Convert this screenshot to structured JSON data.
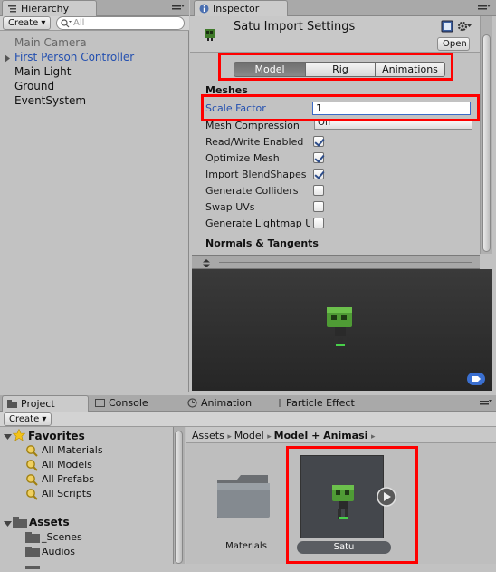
{
  "hierarchy": {
    "tab_label": "Hierarchy",
    "create_label": "Create ▾",
    "search_placeholder": "All",
    "items": [
      "Main Camera",
      "First Person Controller",
      "Main Light",
      "Ground",
      "EventSystem"
    ]
  },
  "inspector": {
    "tab_label": "Inspector",
    "title": "Satu Import Settings",
    "open_label": "Open",
    "tabs": [
      "Model",
      "Rig",
      "Animations"
    ],
    "selected_tab": "Model",
    "section_meshes": "Meshes",
    "scale_factor_label": "Scale Factor",
    "scale_factor_value": "1",
    "mesh_compression_label": "Mesh Compression",
    "mesh_compression_value": "Off",
    "options": [
      {
        "label": "Read/Write Enabled",
        "checked": true
      },
      {
        "label": "Optimize Mesh",
        "checked": true
      },
      {
        "label": "Import BlendShapes",
        "checked": true
      },
      {
        "label": "Generate Colliders",
        "checked": false
      },
      {
        "label": "Swap UVs",
        "checked": false
      },
      {
        "label": "Generate Lightmap UVs",
        "checked": false
      }
    ],
    "section_normals": "Normals & Tangents"
  },
  "bottom_tabs": [
    "Project",
    "Console",
    "Animation",
    "Particle Effect"
  ],
  "project": {
    "create_label": "Create ▾",
    "favorites_label": "Favorites",
    "favorites": [
      "All Materials",
      "All Models",
      "All Prefabs",
      "All Scripts"
    ],
    "assets_label": "Assets",
    "asset_folders": [
      "_Scenes",
      "Audios"
    ],
    "breadcrumb": [
      "Assets",
      "Model",
      "Model + Animasi"
    ],
    "grid_items": [
      {
        "label": "Materials",
        "kind": "folder"
      },
      {
        "label": "Satu",
        "kind": "model"
      }
    ]
  },
  "colors": {
    "highlight": "#ff0000",
    "link_blue": "#2450b0"
  }
}
